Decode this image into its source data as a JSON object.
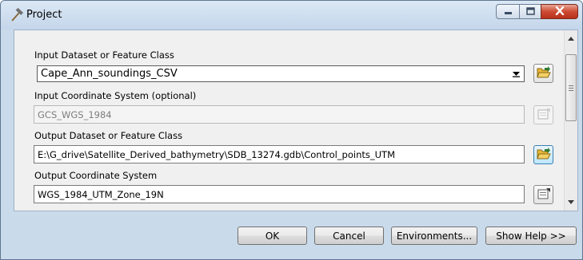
{
  "window": {
    "title": "Project"
  },
  "fields": {
    "input_dataset": {
      "label": "Input Dataset or Feature Class",
      "value": "Cape_Ann_soundings_CSV"
    },
    "input_cs": {
      "label": "Input Coordinate System (optional)",
      "value": "GCS_WGS_1984"
    },
    "output_dataset": {
      "label": "Output Dataset or Feature Class",
      "value": "E:\\G_drive\\Satellite_Derived_bathymetry\\SDB_13274.gdb\\Control_points_UTM"
    },
    "output_cs": {
      "label": "Output Coordinate System",
      "value": "WGS_1984_UTM_Zone_19N"
    }
  },
  "buttons": {
    "ok": "OK",
    "cancel": "Cancel",
    "environments": "Environments...",
    "show_help": "Show Help >>"
  },
  "icons": {
    "app": "hammer-icon",
    "browse": "open-folder-icon",
    "coordinate_system": "properties-icon"
  },
  "colors": {
    "frame": "#c9daea",
    "panel": "#f0f0f0",
    "close_button": "#c8452c",
    "folder": "#e8b73a"
  }
}
